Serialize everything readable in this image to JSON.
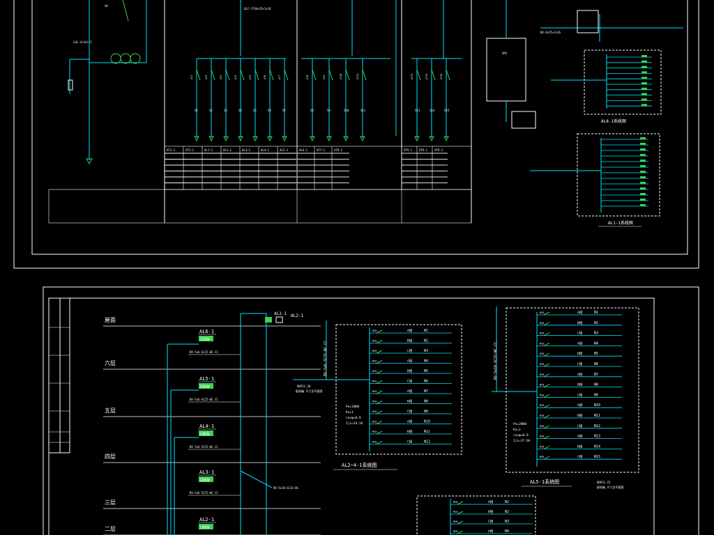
{
  "colors": {
    "background": "#000000",
    "border": "#ffffff",
    "bus": "#00e5ff",
    "text": "#ffffff",
    "highlight": "#39d353",
    "accent": "#ffff00"
  },
  "top_sheet": {
    "feeder_note": "LGL-4/4x2.5",
    "main_cable": "GLC-YJV4x35+1x16",
    "right_cable": "BV-4x25+1x16",
    "ups_label": "UPS",
    "left_circuits": [
      "AT1",
      "AT2",
      "AT3",
      "AT4",
      "AT5",
      "AT6",
      "AT7"
    ],
    "mid_circuits": [
      "AT8",
      "AT9",
      "AT10",
      "AT11"
    ],
    "right_circuits": [
      "AT12",
      "AT13",
      "AT14"
    ],
    "left_ids": [
      "S1",
      "S2",
      "S3",
      "S4",
      "S5",
      "S6",
      "S7"
    ],
    "mid_ids": [
      "S8",
      "S9",
      "S10",
      "S11",
      "S12"
    ],
    "right_ids": [
      "S13",
      "S14",
      "S15"
    ],
    "table_headers": [
      "AT1-1",
      "AT2-1",
      "AL1-1",
      "AL2-1",
      "AL3-1",
      "AL4-1",
      "AL5-1"
    ],
    "table_mid_headers": [
      "AL6-1",
      "AT7-1",
      "AT8-1"
    ],
    "table_right_headers": [
      "AT9-1",
      "AT9-1",
      "AT9-2"
    ],
    "panel_al8": "AL8-1系统图",
    "panel_al1": "AL1-1系统图"
  },
  "bottom_sheet": {
    "floors": [
      "屋面",
      "六层",
      "五层",
      "四层",
      "三层",
      "二层"
    ],
    "riser_top": "AL2-1",
    "riser_top2": "AL2-1",
    "panels": [
      {
        "name": "AL6-1",
        "power": "25KW",
        "cable": "BV-5x6-SC25-WC.CC"
      },
      {
        "name": "AL5-1",
        "power": "20KW",
        "cable": "BV-5x6-SC25-WC.CC"
      },
      {
        "name": "AL4-1",
        "power": "18KW",
        "cable": "BV-5x6-SC25-WC.CC"
      },
      {
        "name": "AL3-1",
        "power": "18KW",
        "cable": "BV-5x6-SC25-WC.CC"
      },
      {
        "name": "AL2-1",
        "power": "18KW",
        "cable": "BV-5x6-SC25-WC.CC"
      }
    ],
    "riser_cable": "BV-5x10-SC32-WC",
    "al24_title": "AL2~4-1系统图",
    "al51_title": "AL5-1系统图",
    "al24_circuits": [
      "N1",
      "N2",
      "N3",
      "N4",
      "N5",
      "N6",
      "N7",
      "N8",
      "N9",
      "N10",
      "N11",
      "N12"
    ],
    "al51_circuits": [
      "N1",
      "N2",
      "N3",
      "N4",
      "N5",
      "N6",
      "N7",
      "N8",
      "N9",
      "N10",
      "N11",
      "N12",
      "N13",
      "N14",
      "N15"
    ],
    "al24_phases": [
      "A相",
      "B相",
      "C相",
      "A相",
      "B相",
      "C相",
      "A相",
      "B相",
      "C相",
      "A相",
      "B相",
      "C相"
    ],
    "al51_phases": [
      "A相",
      "B相",
      "C相",
      "A相",
      "B相",
      "C相",
      "A相",
      "B相",
      "C相",
      "A相",
      "B相",
      "C相",
      "A相",
      "B相",
      "C相"
    ],
    "al24_feed": "BV-5x6-SC25-WC.CC",
    "al51_feed": "BV-5x10-SC32-WC.CC",
    "al24_incomer": "HDP11-20",
    "al51_incomer": "HDP11-25",
    "al24_main_note": "配电箱 尺寸见平面图",
    "al51_main_note": "配电箱 尺寸见平面图",
    "al24_params": [
      "Pe=18KW",
      "Kx=1",
      "cosφ=0.8",
      "Ijs=34.1A"
    ],
    "al51_params": [
      "Pe=20KW",
      "Kx=1",
      "cosφ=0.8",
      "Ijs=37.9A"
    ],
    "bottom_circuits": [
      "N1",
      "N2",
      "N3",
      "N4"
    ]
  }
}
